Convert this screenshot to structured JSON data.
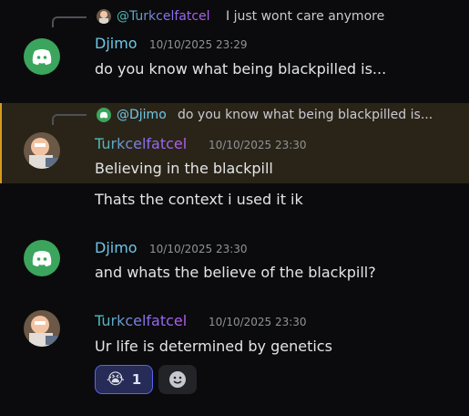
{
  "messages": [
    {
      "reply": {
        "author": "@Turkcelfatcel",
        "text": "I just wont care anymore"
      },
      "author": "Djimo",
      "timestamp": "10/10/2025 23:29",
      "lines": [
        "do you know what being blackpilled is..."
      ]
    },
    {
      "reply": {
        "author": "@Djimo",
        "text": "do you know what being blackpilled is..."
      },
      "author": "Turkcelfatcel",
      "timestamp": "10/10/2025 23:30",
      "lines": [
        "Believing in the blackpill",
        "Thats the context i used it ik"
      ]
    },
    {
      "author": "Djimo",
      "timestamp": "10/10/2025 23:30",
      "lines": [
        "and whats the believe of the blackpill?"
      ]
    },
    {
      "author": "Turkcelfatcel",
      "timestamp": "10/10/2025 23:30",
      "lines": [
        "Ur life is determined by genetics"
      ],
      "reactions": [
        {
          "emoji": "😭",
          "count": "1"
        }
      ]
    }
  ],
  "icons": {
    "discord_avatar": "discord-logo-icon",
    "user_avatar": "cartoon-character-avatar",
    "add_reaction": "smiley-face-icon"
  },
  "colors": {
    "background": "#0b0b0d",
    "highlight": "#2a2418",
    "highlight_bar": "#d59b1f",
    "djimo_name": "#6fc6e8",
    "discord_green": "#3ba55d"
  }
}
